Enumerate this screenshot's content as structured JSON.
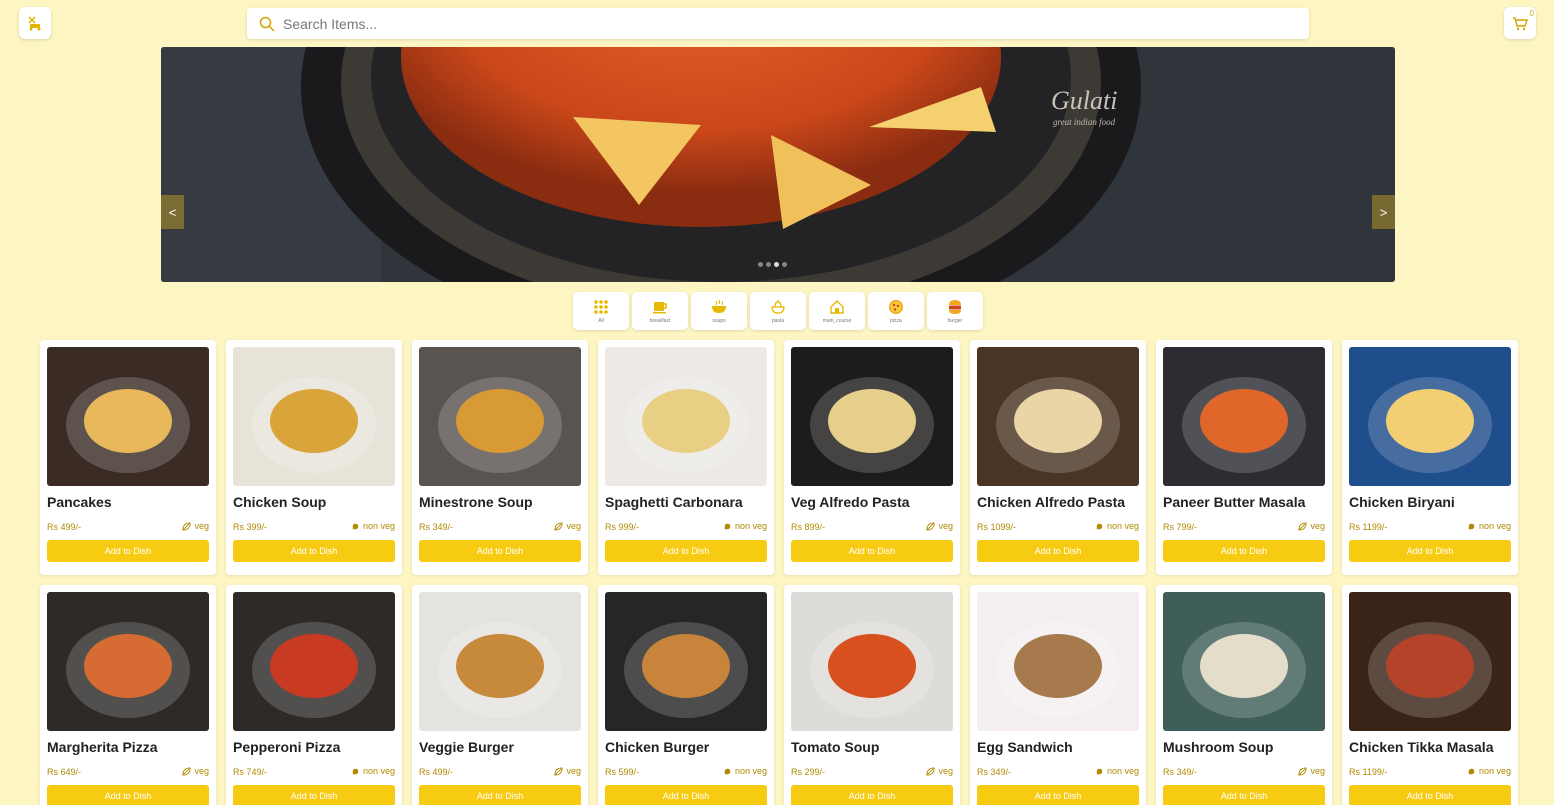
{
  "header": {
    "logo_icon": "scooter-food-icon",
    "search_placeholder": "Search Items...",
    "cart_count": "0",
    "cart_icon": "cart-icon"
  },
  "carousel": {
    "prev_label": "<",
    "next_label": ">",
    "brand_text": "Gulati",
    "brand_sub": "great indian food",
    "slide_count": 4,
    "active_slide": 3
  },
  "categories": [
    {
      "label": "All",
      "icon": "grid-icon"
    },
    {
      "label": "breakfast",
      "icon": "coffee-icon"
    },
    {
      "label": "soups",
      "icon": "soup-bowl-icon"
    },
    {
      "label": "pasta",
      "icon": "pasta-icon"
    },
    {
      "label": "main_course",
      "icon": "house-dish-icon"
    },
    {
      "label": "pizza",
      "icon": "pizza-icon"
    },
    {
      "label": "burger",
      "icon": "burger-king-icon"
    }
  ],
  "items": [
    {
      "name": "Pancakes",
      "price": "Rs 499/-",
      "type": "veg",
      "bg": "#3a2c25",
      "accent": "#e8b85b"
    },
    {
      "name": "Chicken Soup",
      "price": "Rs 399/-",
      "type": "non veg",
      "bg": "#e7e3d9",
      "accent": "#d9a43a"
    },
    {
      "name": "Minestrone Soup",
      "price": "Rs 349/-",
      "type": "veg",
      "bg": "#5a5450",
      "accent": "#d79a35"
    },
    {
      "name": "Spaghetti Carbonara",
      "price": "Rs 999/-",
      "type": "non veg",
      "bg": "#ece9e6",
      "accent": "#e9cf83"
    },
    {
      "name": "Veg Alfredo Pasta",
      "price": "Rs 899/-",
      "type": "veg",
      "bg": "#1d1c1a",
      "accent": "#e5cf8b"
    },
    {
      "name": "Chicken Alfredo Pasta",
      "price": "Rs 1099/-",
      "type": "non veg",
      "bg": "#4a3424",
      "accent": "#e9d5a6"
    },
    {
      "name": "Paneer Butter Masala",
      "price": "Rs 799/-",
      "type": "veg",
      "bg": "#2b2d33",
      "accent": "#e0662a"
    },
    {
      "name": "Chicken Biryani",
      "price": "Rs 1199/-",
      "type": "non veg",
      "bg": "#1f4e8c",
      "accent": "#f3cf73"
    },
    {
      "name": "Margherita Pizza",
      "price": "Rs 649/-",
      "type": "veg",
      "bg": "#2d2a28",
      "accent": "#d76b34"
    },
    {
      "name": "Pepperoni Pizza",
      "price": "Rs 749/-",
      "type": "non veg",
      "bg": "#2d2a28",
      "accent": "#c93a22"
    },
    {
      "name": "Veggie Burger",
      "price": "Rs 499/-",
      "type": "veg",
      "bg": "#e5e3e0",
      "accent": "#c78a3c"
    },
    {
      "name": "Chicken Burger",
      "price": "Rs 599/-",
      "type": "non veg",
      "bg": "#262626",
      "accent": "#c8843a"
    },
    {
      "name": "Tomato Soup",
      "price": "Rs 299/-",
      "type": "veg",
      "bg": "#dedcd8",
      "accent": "#d9501f"
    },
    {
      "name": "Egg Sandwich",
      "price": "Rs 349/-",
      "type": "non veg",
      "bg": "#f5eef0",
      "accent": "#a67a4c"
    },
    {
      "name": "Mushroom Soup",
      "price": "Rs 349/-",
      "type": "veg",
      "bg": "#3f5e5a",
      "accent": "#e4ddc9"
    },
    {
      "name": "Chicken Tikka Masala",
      "price": "Rs 1199/-",
      "type": "non veg",
      "bg": "#3a2418",
      "accent": "#b5432a"
    }
  ],
  "add_label": "Add to Dish",
  "colors": {
    "background": "#fdf6c3",
    "accent": "#f8cb13",
    "price_text": "#b08a00"
  }
}
